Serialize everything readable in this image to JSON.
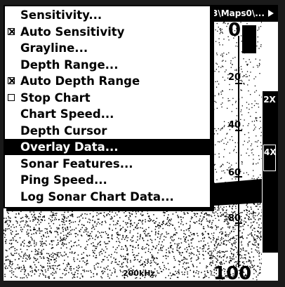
{
  "title_bar": {
    "text": "3\\Maps0\\...",
    "arrow_icon": "right-triangle-icon"
  },
  "menu": {
    "items": [
      {
        "label": "Sensitivity...",
        "checkbox": null,
        "selected": false
      },
      {
        "label": "Auto Sensitivity",
        "checkbox": "checked",
        "selected": false
      },
      {
        "label": "Grayline...",
        "checkbox": null,
        "selected": false
      },
      {
        "label": "Depth Range...",
        "checkbox": null,
        "selected": false
      },
      {
        "label": "Auto Depth Range",
        "checkbox": "checked",
        "selected": false
      },
      {
        "label": "Stop Chart",
        "checkbox": "unchecked",
        "selected": false
      },
      {
        "label": "Chart Speed...",
        "checkbox": null,
        "selected": false
      },
      {
        "label": "Depth Cursor",
        "checkbox": null,
        "selected": false
      },
      {
        "label": "Overlay Data...",
        "checkbox": null,
        "selected": true
      },
      {
        "label": "Sonar Features...",
        "checkbox": null,
        "selected": false
      },
      {
        "label": "Ping Speed...",
        "checkbox": null,
        "selected": false
      },
      {
        "label": "Log Sonar Chart Data...",
        "checkbox": null,
        "selected": false
      }
    ]
  },
  "sonar": {
    "depth_top": "0",
    "depth_bottom": "100",
    "depth_ticks": [
      "20",
      "40",
      "60",
      "80"
    ],
    "frequency": "200kHz",
    "zoom": {
      "upper": "2X",
      "lower": "4X"
    }
  },
  "colors": {
    "background": "#ffffff",
    "foreground": "#000000",
    "selection": "#000000"
  }
}
